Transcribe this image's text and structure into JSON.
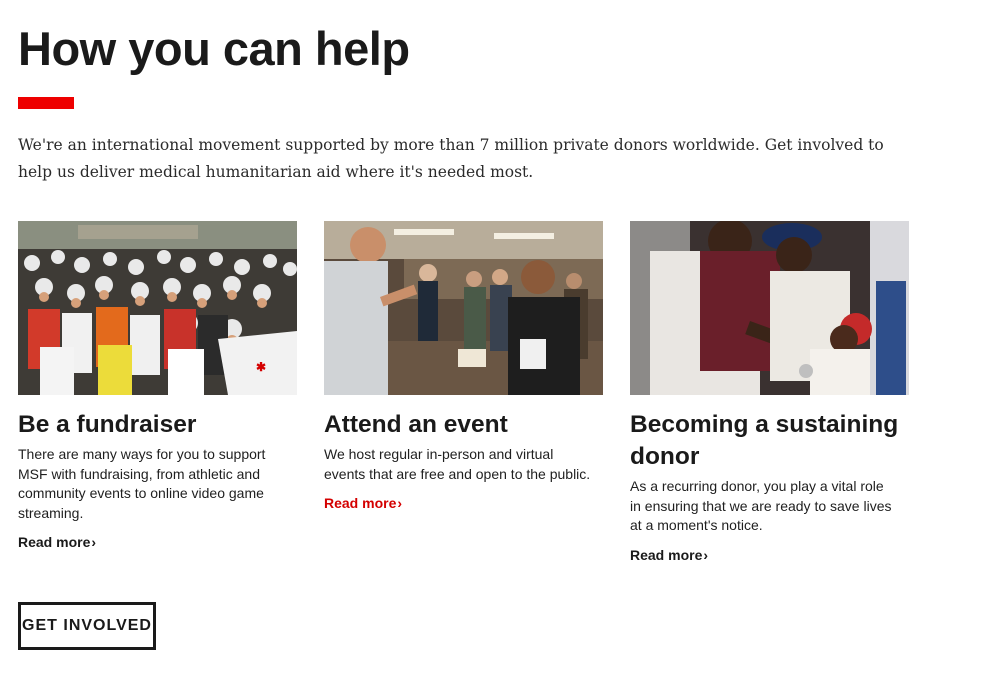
{
  "header": {
    "title": "How you can help",
    "accent_color": "#ee0000"
  },
  "intro": {
    "text": "We're an international movement supported by more than 7 million private donors worldwide. Get involved to help us deliver medical humanitarian aid where it's needed most."
  },
  "cards": [
    {
      "image": "photo-cyclists-fundraiser",
      "title": "Be a fundraiser",
      "description": "There are many ways for you to support MSF with fundraising, from athletic and community events to online video game streaming.",
      "link_label": "Read more",
      "link_color": "#1a1a1a"
    },
    {
      "image": "photo-event-attendees",
      "title": "Attend an event",
      "description": "We host regular in-person and virtual events that are free and open to the public.",
      "link_label": "Read more",
      "link_color": "#d40000"
    },
    {
      "image": "photo-medical-care-child",
      "title": "Becoming a sustaining donor",
      "description": "As a recurring donor, you play a vital role in ensuring that we are ready to save lives at a moment's notice.",
      "link_label": "Read more",
      "link_color": "#1a1a1a"
    }
  ],
  "cta": {
    "label": "GET INVOLVED"
  },
  "icons": {
    "link_arrow": "chevron-right-icon"
  }
}
